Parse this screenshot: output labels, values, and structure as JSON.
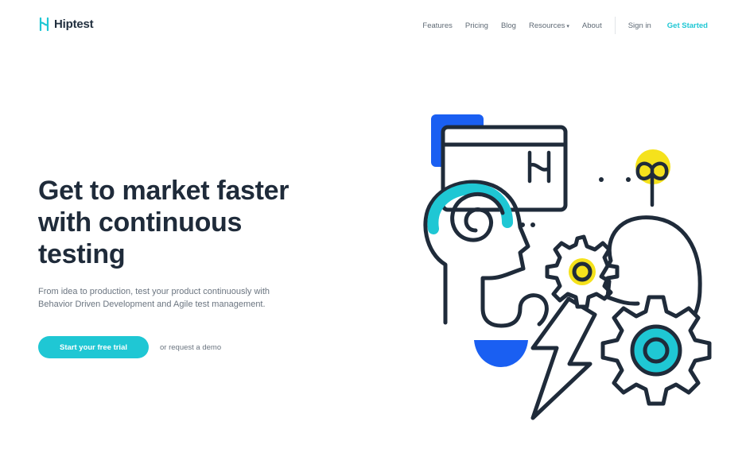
{
  "brand": {
    "name": "Hiptest",
    "accent": "#1fc7d4",
    "ink": "#1f2b3a",
    "yellow": "#f5e21c",
    "blue": "#1a5ff2"
  },
  "nav": {
    "items": [
      "Features",
      "Pricing",
      "Blog",
      "Resources",
      "About"
    ],
    "resources_caret": "▾",
    "sign_in": "Sign in",
    "get_started": "Get Started"
  },
  "hero": {
    "title_lines": [
      "Get to market faster",
      "with continuous",
      "testing"
    ],
    "subtitle_lines": [
      "From idea to production, test your product continuously with",
      "Behavior Driven Development and Agile test management."
    ],
    "cta_label": "Start your free trial",
    "demo_link": "or request a demo"
  },
  "icons": {
    "logo": "hiptest-logo-icon",
    "illustration": "continuous-testing-illustration"
  }
}
